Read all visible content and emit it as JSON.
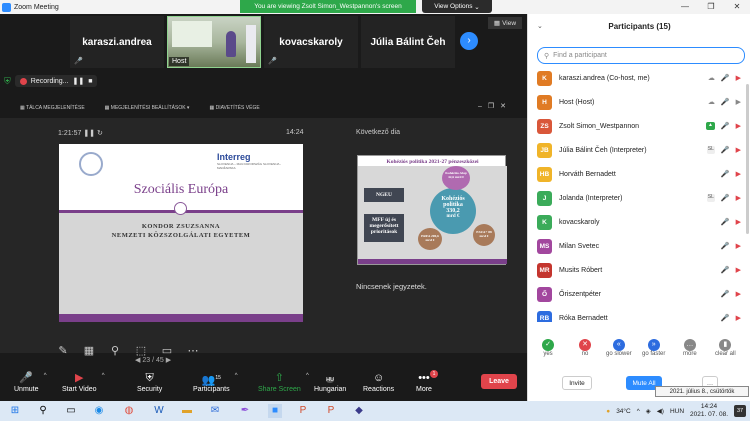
{
  "window": {
    "title": "Zoom Meeting",
    "controls": [
      "—",
      "❐",
      "✕"
    ]
  },
  "banner": {
    "viewing": "You are viewing Zsolt Simon_Westpannon's screen",
    "view_options": "View Options",
    "view_options_caret": "⌄"
  },
  "thumbs": {
    "items": [
      "karaszi.andrea",
      "kovacskaroly",
      "Júlia Bálint Čeh"
    ],
    "host_label": "Host",
    "view_button": "View"
  },
  "recording": {
    "label": "Recording..."
  },
  "presenter_toolbar": {
    "items": [
      "TÁLCA MEGJELENÍTÉSE",
      "MEGJELENÍTÉSI BEÁLLÍTÁSOK ▾",
      "DIAVETÍTÉS VÉGE"
    ]
  },
  "presenter": {
    "timer": "1:21:57",
    "clock": "14:24",
    "next_label": "Következő dia",
    "notes": "Nincsenek jegyzetek.",
    "slide_nav": "23 / 45"
  },
  "slide": {
    "logo_text": "Interreg",
    "logo_sub": "SLOVENIJA – MAGYARORSZÁG\nSLOVENIJA - MADŽARSKA",
    "title": "Szociális Európa",
    "author": "KONDOR ZSUZSANNA",
    "institution": "NEMZETI KÖZSZOLGÁLATI EGYETEM"
  },
  "next_slide": {
    "title": "Kohéziós politika 2021-27 pénzeszközei",
    "box1": "NGEU",
    "box2": "MFF új és megerősített prioritások",
    "center1": "Kohéziós",
    "center2": "politika",
    "center3": "330,2",
    "center4": "mrd €",
    "b1": "Kohéziós Alap 42,6 mrd €",
    "b2": "ERFA 200,6 mrd €",
    "b3": "ESZA+ 88 mrd €"
  },
  "toolbar": {
    "unmute": "Unmute",
    "start_video": "Start Video",
    "security": "Security",
    "participants": "Participants",
    "participants_count": "15",
    "share_screen": "Share Screen",
    "hungarian": "Hungarian",
    "hungarian_code": "HU",
    "reactions": "Reactions",
    "more": "More",
    "more_badge": "1",
    "leave": "Leave"
  },
  "panel": {
    "title": "Participants (15)",
    "search_placeholder": "Find a participant",
    "participants": [
      {
        "initials": "K",
        "name": "karaszi.andrea (Co-host, me)",
        "color": "#e07b24"
      },
      {
        "initials": "H",
        "name": "Host (Host)",
        "color": "#e07b24"
      },
      {
        "initials": "ZS",
        "name": "Zsolt Simon_Westpannon",
        "color": "#d9573a"
      },
      {
        "initials": "JB",
        "name": "Júlia Bálint Čeh (Interpreter)",
        "color": "#f0b429"
      },
      {
        "initials": "HB",
        "name": "Horváth Bernadett",
        "color": "#f0b429"
      },
      {
        "initials": "J",
        "name": "Jolanda (Interpreter)",
        "color": "#3bab5a"
      },
      {
        "initials": "K",
        "name": "kovacskaroly",
        "color": "#3bab5a"
      },
      {
        "initials": "MS",
        "name": "Milan Svetec",
        "color": "#a2479e"
      },
      {
        "initials": "MR",
        "name": "Musits Róbert",
        "color": "#c4352e"
      },
      {
        "initials": "Ő",
        "name": "Őriszentpéter",
        "color": "#a2479e"
      },
      {
        "initials": "RB",
        "name": "Róka Bernadett",
        "color": "#2d6cdf"
      }
    ],
    "reactions": [
      {
        "label": "yes",
        "glyph": "✓",
        "color": "#2ea84a"
      },
      {
        "label": "no",
        "glyph": "✕",
        "color": "#e0444b"
      },
      {
        "label": "go slower",
        "glyph": "«",
        "color": "#2d6cdf"
      },
      {
        "label": "go faster",
        "glyph": "»",
        "color": "#2d6cdf"
      },
      {
        "label": "more",
        "glyph": "…",
        "color": "#888888"
      },
      {
        "label": "clear all",
        "glyph": "▮",
        "color": "#888888"
      }
    ],
    "invite": "Invite",
    "mute_all": "Mute All",
    "more": "…"
  },
  "tooltip": {
    "text": "2021. július 8., csütörtök"
  },
  "taskbar": {
    "temp": "34°C",
    "lang": "HUN",
    "time": "14:24",
    "date": "2021. 07. 08.",
    "notif": "37"
  }
}
